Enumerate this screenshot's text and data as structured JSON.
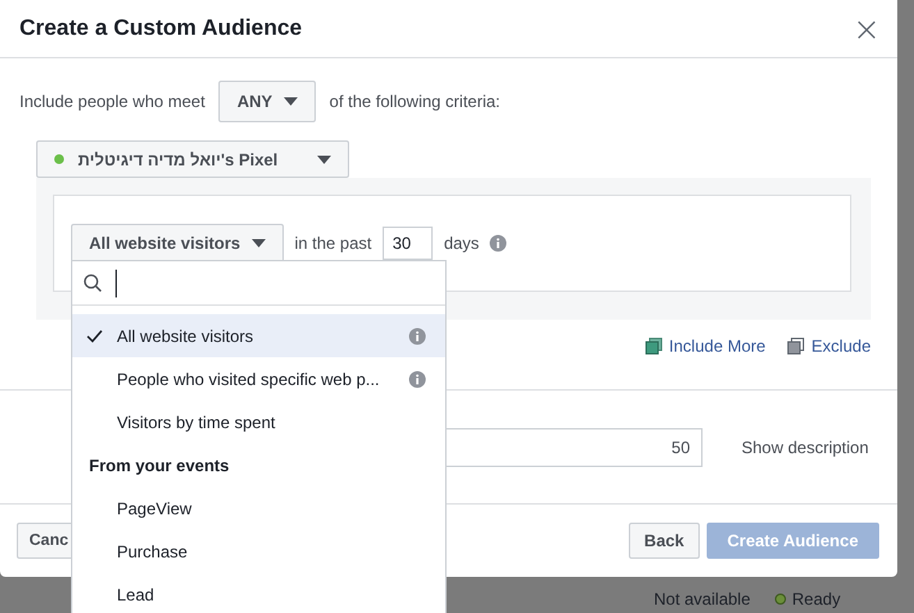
{
  "dialog": {
    "title": "Create a Custom Audience",
    "close": "×"
  },
  "criteria": {
    "prefix": "Include people who meet",
    "match": "ANY",
    "suffix": "of the following criteria:"
  },
  "pixel": {
    "name": "יואל מדיה דיגיטלית's Pixel"
  },
  "rule": {
    "event": "All website visitors",
    "in_the_past": "in the past",
    "days_value": "30",
    "days": "days"
  },
  "links": [
    {
      "label": "Include More",
      "kind": "include"
    },
    {
      "label": "Exclude",
      "kind": "exclude"
    }
  ],
  "name_row": {
    "counter": "50",
    "show_description": "Show description"
  },
  "footer": {
    "cancel": "Canc",
    "back": "Back",
    "create": "Create Audience"
  },
  "background": {
    "status": "Not available",
    "ready": "Ready"
  },
  "dropdown": {
    "items": [
      {
        "kind": "option",
        "label": "All website visitors",
        "selected": true,
        "info": true
      },
      {
        "kind": "option",
        "label": "People who visited specific web p...",
        "selected": false,
        "info": true
      },
      {
        "kind": "option",
        "label": "Visitors by time spent",
        "selected": false,
        "info": false
      },
      {
        "kind": "header",
        "label": "From your events"
      },
      {
        "kind": "option",
        "label": "PageView",
        "selected": false,
        "info": false
      },
      {
        "kind": "option",
        "label": "Purchase",
        "selected": false,
        "info": false
      },
      {
        "kind": "option",
        "label": "Lead",
        "selected": false,
        "info": false
      }
    ]
  }
}
